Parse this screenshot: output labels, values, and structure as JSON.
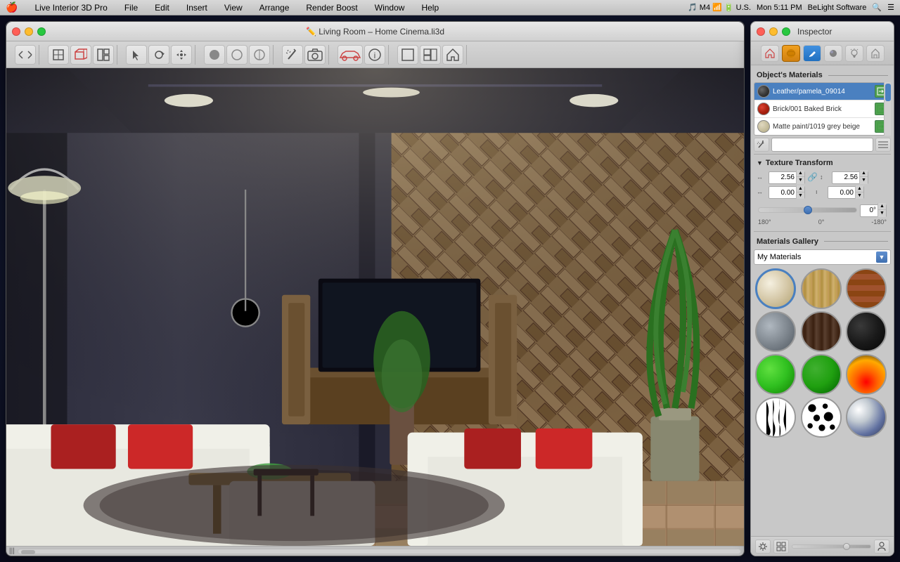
{
  "menubar": {
    "apple": "🍎",
    "items": [
      "Live Interior 3D Pro",
      "File",
      "Edit",
      "Insert",
      "View",
      "Arrange",
      "Render Boost",
      "Window",
      "Help"
    ],
    "right": [
      "🎵",
      "M4",
      "📶",
      "🔋",
      "U.S.",
      "Mon 5:11 PM",
      "BeLight Software",
      "🔍",
      "☰"
    ]
  },
  "window": {
    "title": "✏️  Living Room – Home Cinema.li3d",
    "traffic_lights": [
      "close",
      "minimize",
      "maximize"
    ]
  },
  "toolbar": {
    "buttons": [
      "←→",
      "🏠",
      "📄",
      "≡",
      "↖",
      "↻",
      "✛",
      "⬤",
      "◎",
      "◑",
      "⚑",
      "📷",
      "🚗",
      "ℹ",
      "⬜",
      "⬜",
      "🏠"
    ]
  },
  "inspector": {
    "title": "Inspector",
    "tabs": [
      {
        "icon": "🏠",
        "active": false
      },
      {
        "icon": "●",
        "active": true,
        "color": "orange"
      },
      {
        "icon": "✏",
        "active": true,
        "color": "blue"
      },
      {
        "icon": "🔘",
        "active": false
      },
      {
        "icon": "💡",
        "active": false
      },
      {
        "icon": "🏡",
        "active": false
      }
    ],
    "objects_materials_label": "Object's Materials",
    "materials": [
      {
        "name": "Leather/pamela_09014",
        "swatch_color": "#4a4a4a",
        "selected": true
      },
      {
        "name": "Brick/001 Baked Brick",
        "swatch_color": "#cc3322",
        "selected": false
      },
      {
        "name": "Matte paint/1019 grey beige",
        "swatch_color": "#d4c8aa",
        "selected": false
      }
    ],
    "texture_transform": {
      "label": "Texture Transform",
      "width_value": "2.56",
      "height_value": "2.56",
      "offset_x": "0.00",
      "offset_y": "0.00",
      "rotation_value": "0°",
      "rotation_min": "180°",
      "rotation_zero": "0°",
      "rotation_max": "-180°"
    },
    "gallery": {
      "label": "Materials Gallery",
      "dropdown_label": "My Materials",
      "materials": [
        {
          "type": "cream",
          "class": "mat-cream"
        },
        {
          "type": "wood-light",
          "class": "mat-wood-light"
        },
        {
          "type": "brick",
          "class": "mat-brick"
        },
        {
          "type": "concrete",
          "class": "mat-concrete"
        },
        {
          "type": "dark-wood",
          "class": "mat-dark-wood"
        },
        {
          "type": "black",
          "class": "mat-black"
        },
        {
          "type": "green-bright",
          "class": "mat-green-bright"
        },
        {
          "type": "green-dark",
          "class": "mat-green-dark"
        },
        {
          "type": "fire",
          "class": "mat-fire"
        },
        {
          "type": "zebra",
          "class": "mat-zebra"
        },
        {
          "type": "dalmatian",
          "class": "mat-dalmatian"
        },
        {
          "type": "chrome",
          "class": "mat-chrome"
        }
      ]
    }
  },
  "viewport": {
    "scene_description": "3D living room scene with modern furniture"
  }
}
